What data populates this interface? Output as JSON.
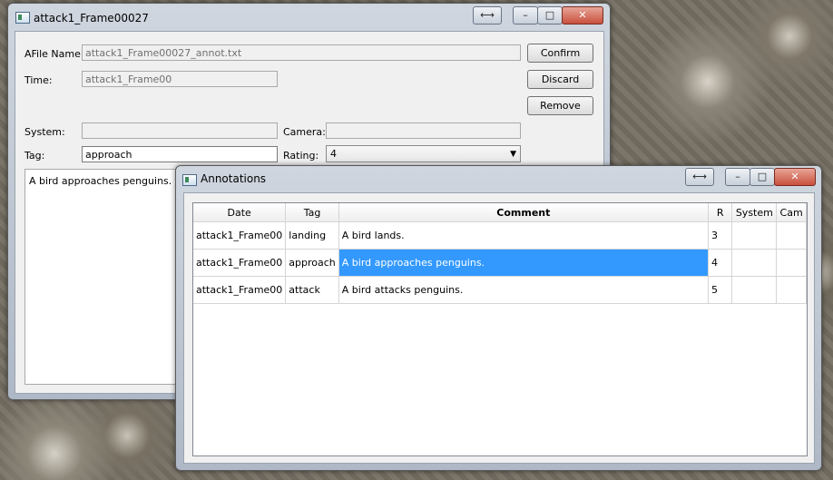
{
  "main_window": {
    "title": "attack1_Frame00027",
    "labels": {
      "afile": "AFile Name:",
      "time": "Time:",
      "system": "System:",
      "camera": "Camera:",
      "tag": "Tag:",
      "rating": "Rating:"
    },
    "fields": {
      "afile_value": "attack1_Frame00027_annot.txt",
      "time_value": "attack1_Frame00",
      "system_value": "",
      "camera_value": "",
      "tag_value": "approach",
      "rating_value": "4"
    },
    "buttons": {
      "confirm": "Confirm",
      "discard": "Discard",
      "remove": "Remove"
    },
    "comment_text": "A bird approaches penguins.",
    "caption_buttons": {
      "resize": "⟷",
      "minimize": "–",
      "maximize": "□",
      "close": "✕"
    }
  },
  "annotations_window": {
    "title": "Annotations",
    "columns": [
      "Date",
      "Tag",
      "Comment",
      "R",
      "System",
      "Cam"
    ],
    "rows": [
      {
        "date": "attack1_Frame00",
        "tag": "landing",
        "comment": "A bird lands.",
        "r": "3",
        "system": "",
        "cam": ""
      },
      {
        "date": "attack1_Frame00",
        "tag": "approach",
        "comment": "A bird approaches penguins.",
        "r": "4",
        "system": "",
        "cam": ""
      },
      {
        "date": "attack1_Frame00",
        "tag": "attack",
        "comment": "A bird attacks penguins.",
        "r": "5",
        "system": "",
        "cam": ""
      }
    ],
    "selected_row": 1,
    "caption_buttons": {
      "resize": "⟷",
      "minimize": "–",
      "maximize": "□",
      "close": "✕"
    }
  },
  "colors": {
    "selection": "#3399ff",
    "close_button": "#c9503d"
  }
}
